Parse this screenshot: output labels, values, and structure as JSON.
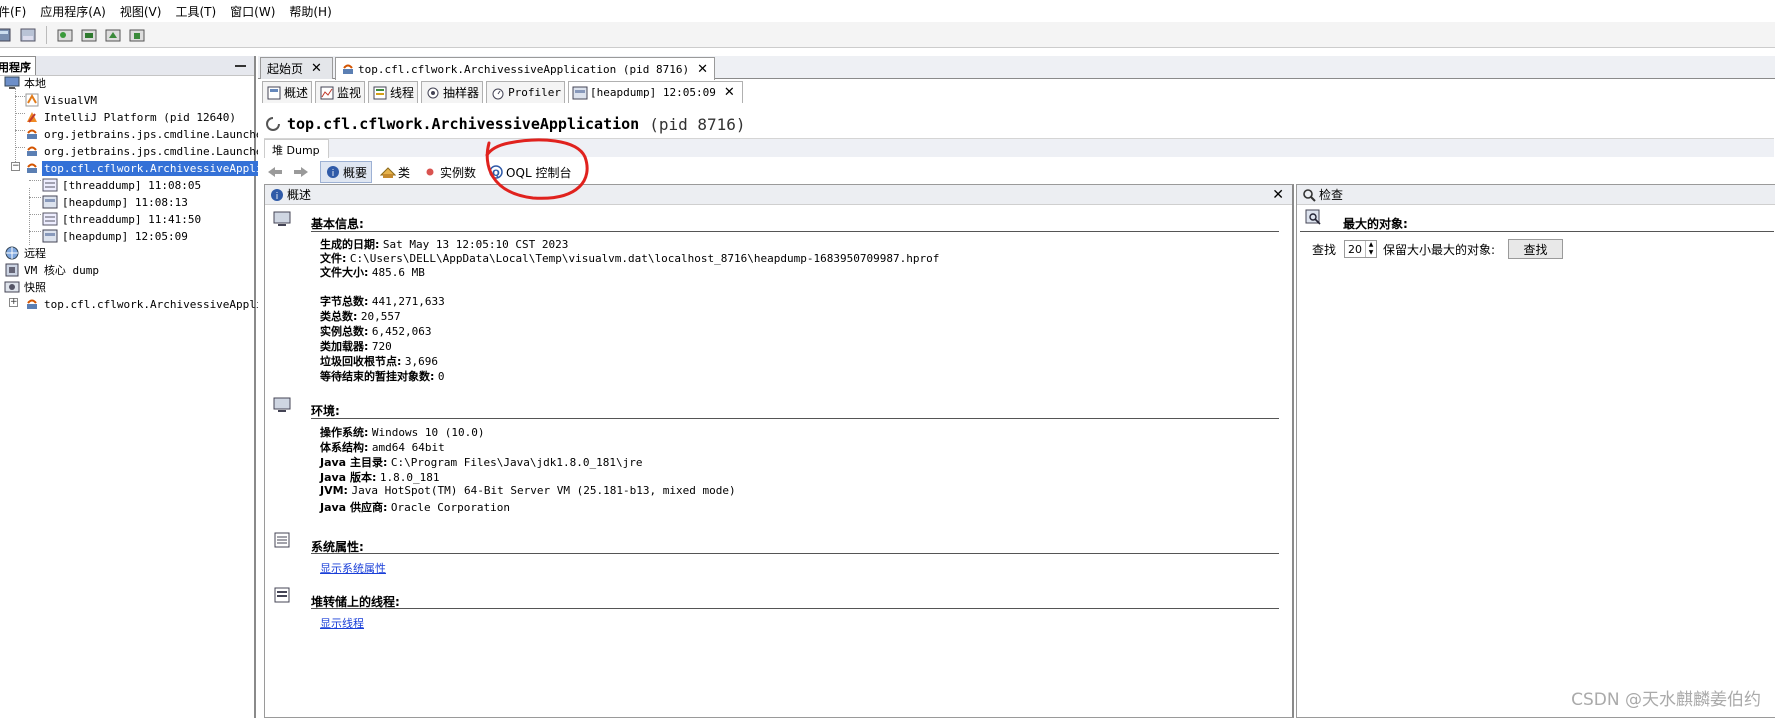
{
  "menu": [
    "件(F)",
    "应用程序(A)",
    "视图(V)",
    "工具(T)",
    "窗口(W)",
    "帮助(H)"
  ],
  "left_panel": {
    "title": "用程序",
    "tree": {
      "local": "本地",
      "visualvm": "VisualVM",
      "intellij": "IntelliJ Platform (pid 12640)",
      "launcher1": "org.jetbrains.jps.cmdline.Launcher",
      "launcher2": "org.jetbrains.jps.cmdline.Launcher",
      "app": "top.cfl.cflwork.ArchivessiveApplica",
      "snap1": "[threaddump] 11:08:05",
      "snap2": "[heapdump] 11:08:13",
      "snap3": "[threaddump] 11:41:50",
      "snap4": "[heapdump] 12:05:09",
      "remote": "远程",
      "vmcore": "VM 核心 dump",
      "snapshots": "快照",
      "snapshot_app": "top.cfl.cflwork.ArchivessiveApplica"
    }
  },
  "tabs": {
    "start": "起始页",
    "app": "top.cfl.cflwork.ArchivessiveApplication (pid 8716)"
  },
  "subtabs": {
    "overview": "概述",
    "monitor": "监视",
    "threads": "线程",
    "sampler": "抽样器",
    "profiler": "Profiler",
    "heapdump": "[heapdump] 12:05:09"
  },
  "app_title": {
    "name": "top.cfl.cflwork.ArchivessiveApplication",
    "pid": "(pid 8716)"
  },
  "dump_tab": "堆 Dump",
  "nav": {
    "summary": "概要",
    "classes": "类",
    "instances": "实例数",
    "oql": "OQL 控制台"
  },
  "overview_panel": {
    "title": "概述",
    "basic": {
      "heading": "基本信息:",
      "date_label": "生成的日期:",
      "date": "Sat May 13 12:05:10 CST 2023",
      "file_label": "文件:",
      "file": "C:\\Users\\DELL\\AppData\\Local\\Temp\\visualvm.dat\\localhost_8716\\heapdump-1683950709987.hprof",
      "size_label": "文件大小:",
      "size": "485.6 MB",
      "bytes_label": "字节总数:",
      "bytes": "441,271,633",
      "classes_label": "类总数:",
      "classes": "20,557",
      "instances_label": "实例总数:",
      "instances": "6,452,063",
      "loaders_label": "类加载器:",
      "loaders": "720",
      "gc_label": "垃圾回收根节点:",
      "gc": "3,696",
      "pending_label": "等待结束的暂挂对象数:",
      "pending": "0"
    },
    "env": {
      "heading": "环境:",
      "os_label": "操作系统:",
      "os": "Windows 10 (10.0)",
      "arch_label": "体系结构:",
      "arch": "amd64 64bit",
      "home_label": "Java 主目录:",
      "home": "C:\\Program Files\\Java\\jdk1.8.0_181\\jre",
      "ver_label": "Java 版本:",
      "ver": "1.8.0_181",
      "jvm_label": "JVM:",
      "jvm": "Java HotSpot(TM) 64-Bit Server VM (25.181-b13, mixed mode)",
      "vendor_label": "Java 供应商:",
      "vendor": "Oracle Corporation"
    },
    "sysprops": {
      "heading": "系统属性:",
      "link": "显示系统属性"
    },
    "threads": {
      "heading": "堆转储上的线程:",
      "link": "显示线程"
    }
  },
  "inspect_panel": {
    "title": "检查",
    "heading": "最大的对象:",
    "find_label": "查找",
    "count": "20",
    "keep_label": "保留大小最大的对象:",
    "button": "查找"
  },
  "watermark": "CSDN @天水麒麟姜伯约",
  "colors": {
    "selection": "#3471d7",
    "link": "#1a3fd8",
    "annotation": "#e0221e"
  }
}
